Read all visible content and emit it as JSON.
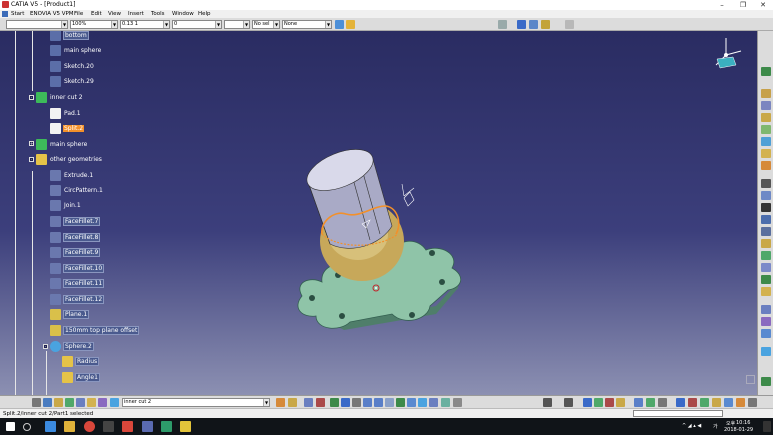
{
  "window": {
    "title": "CATIA V5 - [Product1]",
    "controls": [
      "–",
      "❐",
      "✕"
    ]
  },
  "menu": {
    "items": [
      "Start",
      "ENOVIA V5 VPM",
      "File",
      "Edit",
      "View",
      "Insert",
      "Tools",
      "Window",
      "Help"
    ]
  },
  "toolbar": {
    "combo1": "",
    "zoom": "100%",
    "linetype": "0.13 1",
    "linestyle": "0",
    "layer": "No sel",
    "layer_none": "None"
  },
  "tree": {
    "nodes": [
      {
        "label": "bottom"
      },
      {
        "label": "main sphere"
      },
      {
        "label": "Sketch.20"
      },
      {
        "label": "Sketch.29"
      },
      {
        "label": "inner cut 2"
      },
      {
        "label": "Pad.1"
      },
      {
        "label": "Split.2"
      },
      {
        "label": "main sphere"
      },
      {
        "label": "other geometries"
      },
      {
        "label": "Extrude.1"
      },
      {
        "label": "CircPattern.1"
      },
      {
        "label": "Join.1"
      },
      {
        "label": "FaceFillet.7"
      },
      {
        "label": "FaceFillet.8"
      },
      {
        "label": "FaceFillet.9"
      },
      {
        "label": "FaceFillet.10"
      },
      {
        "label": "FaceFillet.11"
      },
      {
        "label": "FaceFillet.12"
      },
      {
        "label": "Plane.1"
      },
      {
        "label": "150mm top plane offset"
      },
      {
        "label": "Sphere.2"
      },
      {
        "label": "Radius"
      },
      {
        "label": "Angle1"
      }
    ]
  },
  "bottom_toolbar": {
    "current_body": "inner cut 2"
  },
  "status": {
    "text": "Split.2/inner cut 2/Part1 selected"
  },
  "taskbar": {
    "ime": "오후",
    "time": "10:16",
    "date": "2018-01-29",
    "lang": "가"
  },
  "colors": {
    "selection": "#f3902a",
    "viewport_top": "#2a2c62",
    "part_green": "#8fc4a8"
  }
}
